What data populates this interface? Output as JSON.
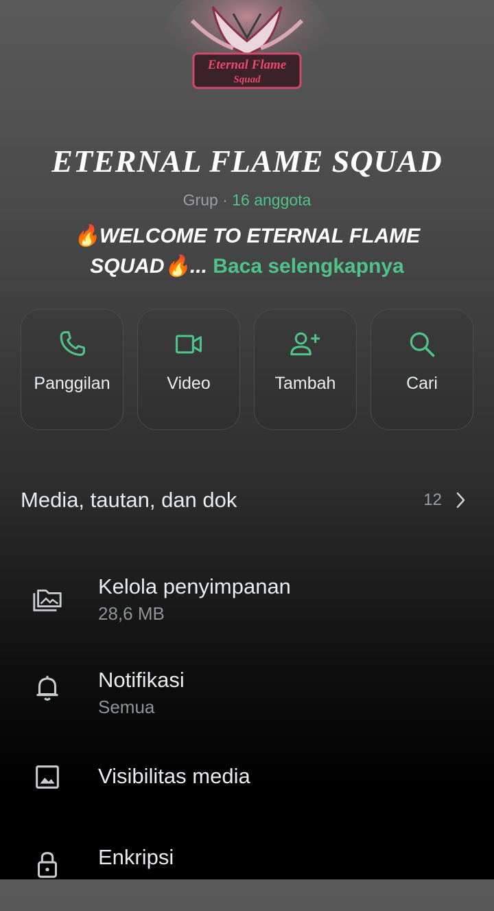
{
  "group": {
    "name": "ETERNAL FLAME SQUAD",
    "type": "Grup",
    "separator": "·",
    "members": "16 anggota",
    "description": "🔥WELCOME TO ETERNAL FLAME SQUAD🔥",
    "ellipsis": "...",
    "read_more": "Baca selengkapnya",
    "logo_text": "Eternal Flame Squad"
  },
  "actions": [
    {
      "label": "Panggilan",
      "icon": "phone-icon"
    },
    {
      "label": "Video",
      "icon": "video-icon"
    },
    {
      "label": "Tambah",
      "icon": "add-person-icon"
    },
    {
      "label": "Cari",
      "icon": "search-icon"
    }
  ],
  "media": {
    "label": "Media, tautan, dan dok",
    "count": "12"
  },
  "settings": [
    {
      "title": "Kelola penyimpanan",
      "subtitle": "28,6 MB",
      "icon": "storage-icon"
    },
    {
      "title": "Notifikasi",
      "subtitle": "Semua",
      "icon": "bell-icon"
    },
    {
      "title": "Visibilitas media",
      "subtitle": "",
      "icon": "image-icon"
    },
    {
      "title": "Enkripsi",
      "subtitle": "",
      "icon": "lock-icon"
    }
  ],
  "colors": {
    "accent": "#4fc38a",
    "text": "#e9edef",
    "muted": "#9aa0a4"
  }
}
